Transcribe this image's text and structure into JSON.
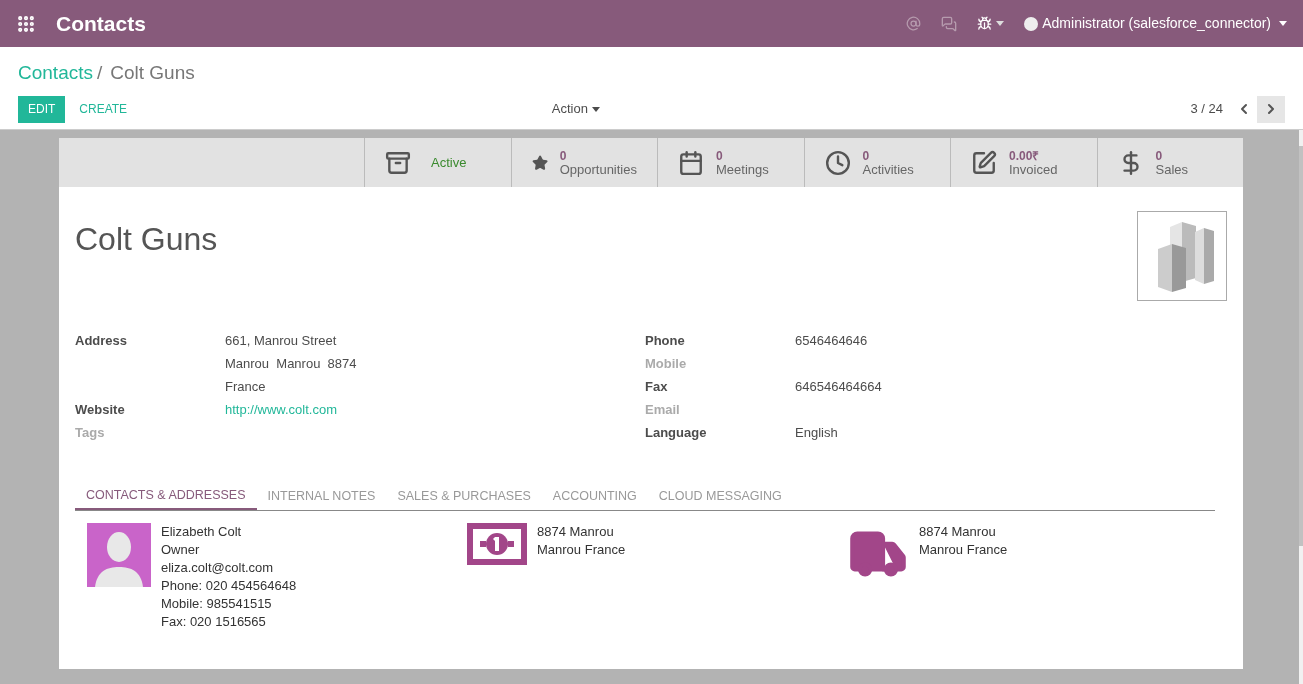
{
  "app_bar": {
    "title": "Contacts",
    "user": "Administrator (salesforce_connector)"
  },
  "breadcrumb": {
    "parent": "Contacts",
    "separator": "/",
    "current": "Colt Guns"
  },
  "buttons": {
    "edit": "EDIT",
    "create": "CREATE",
    "action": "Action"
  },
  "pager": "3 / 24",
  "smart_buttons": [
    {
      "kind": "archive",
      "label": "Active"
    },
    {
      "kind": "star",
      "value": "0",
      "label": "Opportunities"
    },
    {
      "kind": "calendar",
      "value": "0",
      "label": "Meetings"
    },
    {
      "kind": "clock",
      "value": "0",
      "label": "Activities"
    },
    {
      "kind": "edit",
      "value": "0.00₹",
      "label": "Invoiced"
    },
    {
      "kind": "dollar",
      "value": "0",
      "label": "Sales"
    }
  ],
  "name": "Colt Guns",
  "left_fields": [
    {
      "label": "Address",
      "filled": true,
      "lines": [
        "661, Manrou Street",
        "Manrou  Manrou  8874",
        "France"
      ]
    },
    {
      "label": "Website",
      "filled": true,
      "link": true,
      "lines": [
        "http://www.colt.com"
      ]
    },
    {
      "label": "Tags",
      "filled": false
    }
  ],
  "right_fields": [
    {
      "label": "Phone",
      "filled": true,
      "lines": [
        "6546464646"
      ]
    },
    {
      "label": "Mobile",
      "filled": false
    },
    {
      "label": "Fax",
      "filled": true,
      "lines": [
        "646546464664"
      ]
    },
    {
      "label": "Email",
      "filled": false
    },
    {
      "label": "Language",
      "filled": true,
      "lines": [
        "English"
      ]
    }
  ],
  "tabs": [
    {
      "label": "CONTACTS & ADDRESSES",
      "selected": true
    },
    {
      "label": "INTERNAL NOTES",
      "selected": false
    },
    {
      "label": "SALES & PURCHASES",
      "selected": false
    },
    {
      "label": "ACCOUNTING",
      "selected": false
    },
    {
      "label": "CLOUD MESSAGING",
      "selected": false
    }
  ],
  "contacts": [
    {
      "kind": "person",
      "lines": [
        "Elizabeth Colt",
        "Owner",
        "eliza.colt@colt.com",
        "Phone: 020 454564648",
        "Mobile: 985541515",
        "Fax: 020 1516565"
      ]
    },
    {
      "kind": "invoice",
      "lines": [
        "8874 Manrou",
        "Manrou France"
      ]
    },
    {
      "kind": "delivery",
      "lines": [
        "8874 Manrou",
        "Manrou France"
      ]
    }
  ]
}
